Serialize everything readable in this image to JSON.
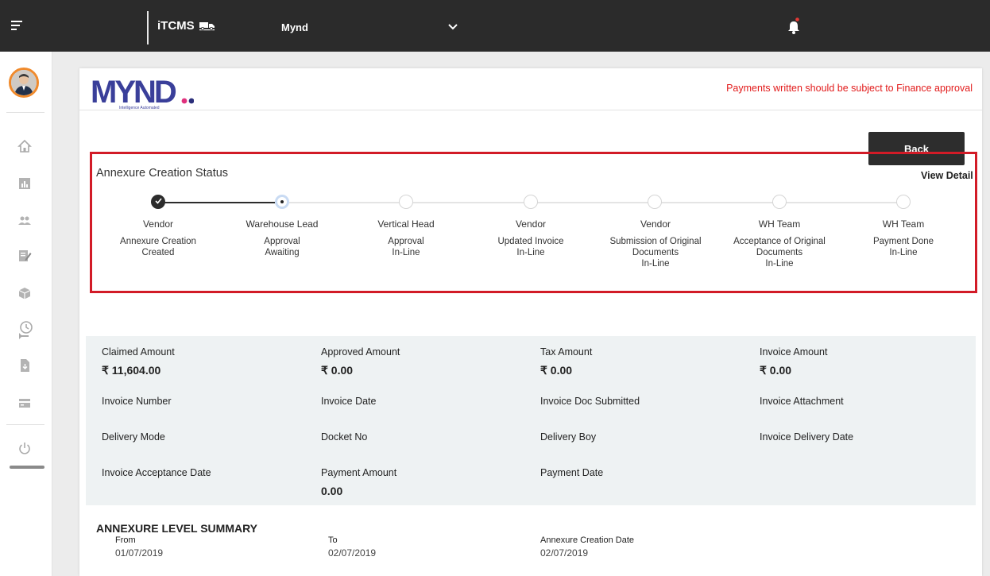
{
  "header": {
    "app_name": "iTCMS",
    "company": "Mynd"
  },
  "card": {
    "logo_text": "MYND",
    "logo_tagline": "Intelligence Automated",
    "notice": "Payments written should be subject to Finance approval",
    "back_label": "Back",
    "status_title": "Annexure Creation Status",
    "view_detail_label": "View Detail"
  },
  "steps": [
    {
      "who": "Vendor",
      "action": "Annexure Creation",
      "state": "Created",
      "status": "done"
    },
    {
      "who": "Warehouse Lead",
      "action": "Approval",
      "state": "Awaiting",
      "status": "current"
    },
    {
      "who": "Vertical Head",
      "action": "Approval",
      "state": "In-Line",
      "status": "pending"
    },
    {
      "who": "Vendor",
      "action": "Updated Invoice",
      "state": "In-Line",
      "status": "pending"
    },
    {
      "who": "Vendor",
      "action": "Submission of Original Documents",
      "state": "In-Line",
      "status": "pending"
    },
    {
      "who": "WH Team",
      "action": "Acceptance of Original Documents",
      "state": "In-Line",
      "status": "pending"
    },
    {
      "who": "WH Team",
      "action": "Payment Done",
      "state": "In-Line",
      "status": "pending"
    }
  ],
  "details": {
    "claimed_amount": {
      "label": "Claimed Amount",
      "value": "₹ 11,604.00"
    },
    "approved_amount": {
      "label": "Approved Amount",
      "value": "₹ 0.00"
    },
    "tax_amount": {
      "label": "Tax Amount",
      "value": "₹ 0.00"
    },
    "invoice_amount": {
      "label": "Invoice Amount",
      "value": "₹ 0.00"
    },
    "invoice_number": {
      "label": "Invoice Number"
    },
    "invoice_date": {
      "label": "Invoice Date"
    },
    "invoice_doc_submitted": {
      "label": "Invoice Doc Submitted"
    },
    "invoice_attachment": {
      "label": "Invoice Attachment"
    },
    "delivery_mode": {
      "label": "Delivery Mode"
    },
    "docket_no": {
      "label": "Docket No"
    },
    "delivery_boy": {
      "label": "Delivery Boy"
    },
    "invoice_delivery_date": {
      "label": "Invoice Delivery Date"
    },
    "invoice_acceptance_date": {
      "label": "Invoice Acceptance Date"
    },
    "payment_amount": {
      "label": "Payment Amount",
      "value": "0.00"
    },
    "payment_date": {
      "label": "Payment Date"
    }
  },
  "summary": {
    "title": "ANNEXURE LEVEL SUMMARY",
    "from_label": "From",
    "from_value": "01/07/2019",
    "to_label": "To",
    "to_value": "02/07/2019",
    "created_label": "Annexure Creation Date",
    "created_value": "02/07/2019"
  },
  "colors": {
    "topbar": "#2b2b2b",
    "notice": "#e21b1b",
    "highlight": "#d21b27",
    "logo_blue": "#3a3f9a",
    "logo_dot_pink": "#e0317d",
    "logo_dot_navy": "#2b2f7a"
  }
}
